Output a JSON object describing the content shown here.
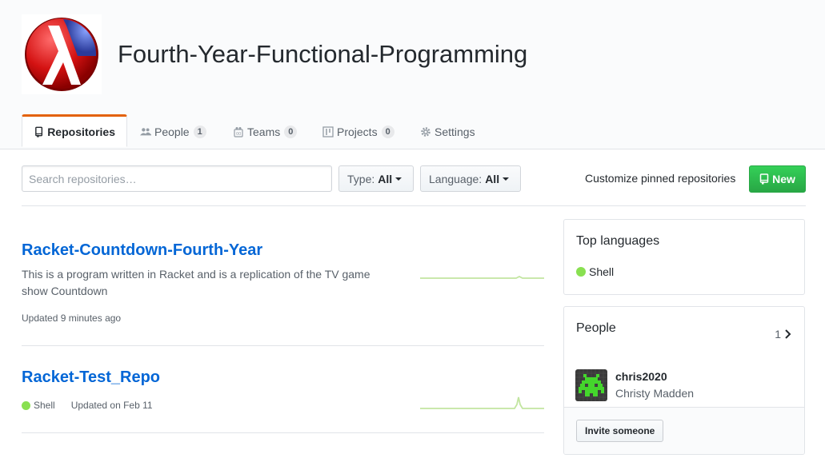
{
  "org": {
    "name": "Fourth-Year-Functional-Programming",
    "logo_icon": "racket-lambda-logo"
  },
  "tabs": [
    {
      "label": "Repositories",
      "icon": "repo-icon",
      "selected": true
    },
    {
      "label": "People",
      "icon": "people-icon",
      "count": "1"
    },
    {
      "label": "Teams",
      "icon": "teams-icon",
      "count": "0"
    },
    {
      "label": "Projects",
      "icon": "project-icon",
      "count": "0"
    },
    {
      "label": "Settings",
      "icon": "gear-icon"
    }
  ],
  "filters": {
    "search_placeholder": "Search repositories…",
    "type_label": "Type:",
    "type_value": "All",
    "language_label": "Language:",
    "language_value": "All",
    "customize_link": "Customize pinned repositories",
    "new_button": "New"
  },
  "repos": [
    {
      "name": "Racket-Countdown-Fourth-Year",
      "description": "This is a program written in Racket and is a replication of the TV game show Countdown",
      "updated": "Updated 9 minutes ago"
    },
    {
      "name": "Racket-Test_Repo",
      "language": "Shell",
      "updated": "Updated on Feb 11"
    }
  ],
  "sidebar": {
    "top_languages_title": "Top languages",
    "languages": [
      {
        "name": "Shell",
        "color": "#89e051"
      }
    ],
    "people_title": "People",
    "people_count": "1",
    "member": {
      "login": "chris2020",
      "name": "Christy Madden"
    },
    "invite_button": "Invite someone"
  },
  "colors": {
    "accent": "#e36209",
    "link": "#0366d6",
    "primary_button": "#28a745",
    "shell": "#89e051"
  }
}
